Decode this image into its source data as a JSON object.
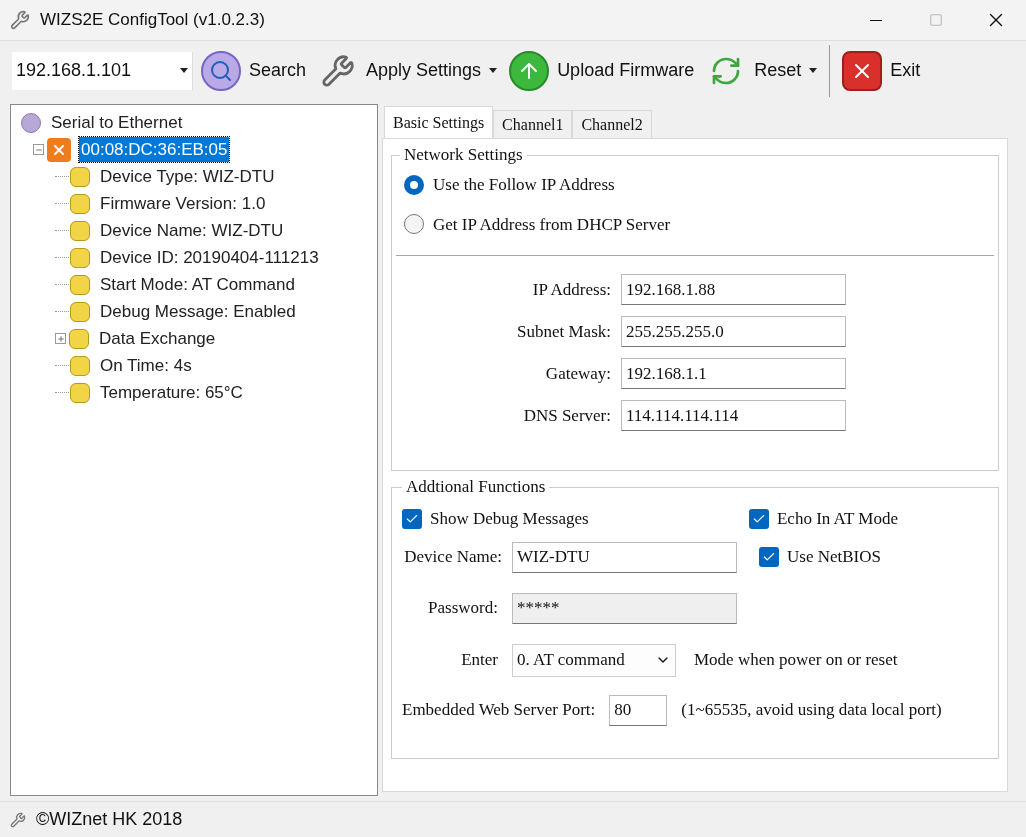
{
  "window": {
    "title": "WIZS2E ConfigTool (v1.0.2.3)"
  },
  "toolbar": {
    "address": "192.168.1.101",
    "buttons": [
      {
        "kind": "search",
        "label": "Search",
        "has_menu": false
      },
      {
        "kind": "apply",
        "label": "Apply Settings",
        "has_menu": true
      },
      {
        "kind": "upload",
        "label": "Upload Firmware",
        "has_menu": false
      },
      {
        "kind": "reset",
        "label": "Reset",
        "has_menu": true
      },
      {
        "kind": "exit",
        "label": "Exit",
        "has_menu": false
      }
    ]
  },
  "tree": [
    {
      "kind": "root",
      "label": "Serial to Ethernet",
      "selected": false,
      "children": [
        {
          "kind": "device",
          "label": "00:08:DC:36:EB:05",
          "selected": true,
          "expanded": true,
          "children": [
            {
              "kind": "item",
              "label": "Device Type: WIZ-DTU",
              "selected": false
            },
            {
              "kind": "item",
              "label": "Firmware Version: 1.0",
              "selected": false
            },
            {
              "kind": "item",
              "label": "Device Name: WIZ-DTU",
              "selected": false
            },
            {
              "kind": "item",
              "label": "Device ID: 20190404-111213",
              "selected": false
            },
            {
              "kind": "item",
              "label": "Start Mode: AT Command",
              "selected": false
            },
            {
              "kind": "item",
              "label": "Debug Message: Enabled",
              "selected": false
            },
            {
              "kind": "item",
              "label": "Data Exchange",
              "selected": false,
              "expanded": false
            },
            {
              "kind": "item",
              "label": "On Time: 4s",
              "selected": false
            },
            {
              "kind": "item",
              "label": "Temperature: 65°C",
              "selected": false
            }
          ]
        }
      ]
    }
  ],
  "tabs": [
    {
      "label": "Basic Settings",
      "selected": true
    },
    {
      "label": "Channel1",
      "selected": false
    },
    {
      "label": "Channel2",
      "selected": false
    }
  ],
  "network_settings": {
    "title": "Network Settings",
    "options": [
      {
        "label": "Use the Follow IP Address",
        "selected": true
      },
      {
        "label": "Get IP Address from DHCP Server",
        "selected": false
      }
    ],
    "fields": [
      {
        "label": "IP Address:",
        "value": "192.168.1.88"
      },
      {
        "label": "Subnet Mask:",
        "value": "255.255.255.0"
      },
      {
        "label": "Gateway:",
        "value": "192.168.1.1"
      },
      {
        "label": "DNS Server:",
        "value": "114.114.114.114"
      }
    ]
  },
  "additional_functions": {
    "title": "Addtional Functions",
    "checkboxes": [
      {
        "label": "Show Debug Messages",
        "checked": true
      },
      {
        "label": "Echo In AT Mode",
        "checked": true
      },
      {
        "label": "Use NetBIOS",
        "checked": true
      }
    ],
    "device_name": {
      "label": "Device Name:",
      "value": "WIZ-DTU"
    },
    "password": {
      "label": "Password:",
      "value": "*****",
      "disabled": true
    },
    "enter": {
      "label": "Enter",
      "value": "0. AT command",
      "note": "Mode when power on or reset"
    },
    "web_port": {
      "label": "Embedded Web Server Port:",
      "value": "80",
      "note": "(1~65535, avoid using data local port)"
    }
  },
  "status_bar": {
    "text": "©WIZnet HK 2018"
  }
}
